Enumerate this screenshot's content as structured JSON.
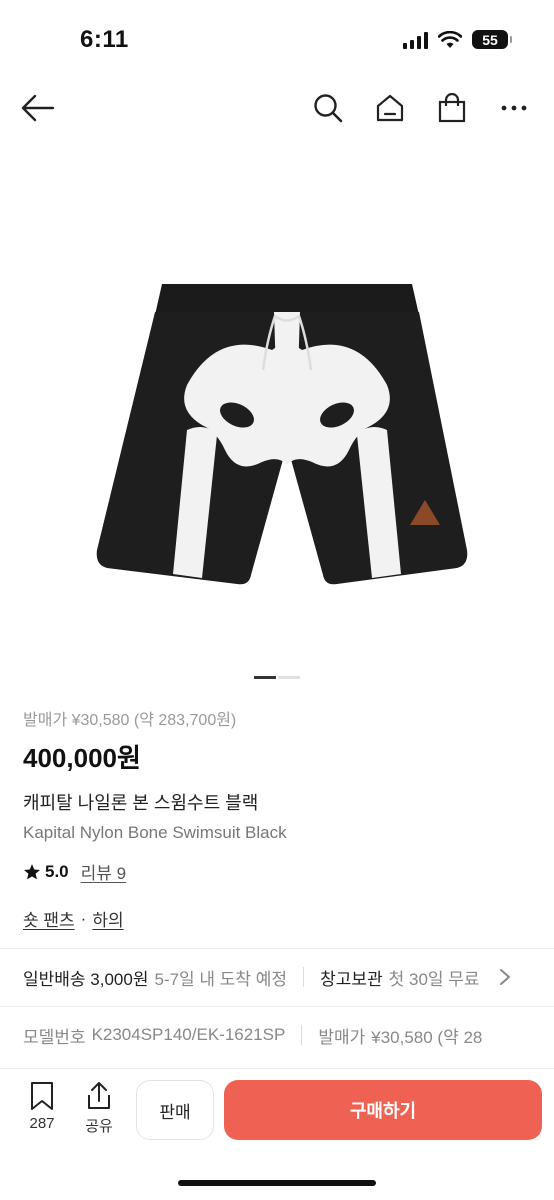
{
  "status": {
    "time": "6:11",
    "battery": "55"
  },
  "nav": {
    "back_icon": "arrow-left-icon",
    "search_icon": "search-icon",
    "home_icon": "home-icon",
    "bag_icon": "shopping-bag-icon",
    "more_icon": "more-icon"
  },
  "product": {
    "image_icon": "shorts-image",
    "release_price": "발매가 ¥30,580 (약 283,700원)",
    "price": "400,000원",
    "name_ko": "캐피탈 나일론 본 스윔수트 블랙",
    "name_en": "Kapital Nylon Bone Swimsuit Black",
    "rating": "5.0",
    "review_label": "리뷰 9",
    "category_main": "숏 팬츠",
    "category_dot": "·",
    "category_sub": "하의",
    "page_count": 2,
    "page_active": 1
  },
  "shipping": {
    "label": "일반배송 3,000원",
    "detail": "5-7일 내 도착 예정",
    "storage_label": "창고보관",
    "storage_detail": "첫 30일 무료"
  },
  "specs": {
    "model_label": "모델번호",
    "model_value": "K2304SP140/EK-1621SP",
    "release_label": "발매가",
    "release_value": "¥30,580 (약 28"
  },
  "bottom": {
    "bookmark_count": "287",
    "share_label": "공유",
    "sell_label": "판매",
    "buy_label": "구매하기",
    "buy_color": "#ef6253"
  }
}
